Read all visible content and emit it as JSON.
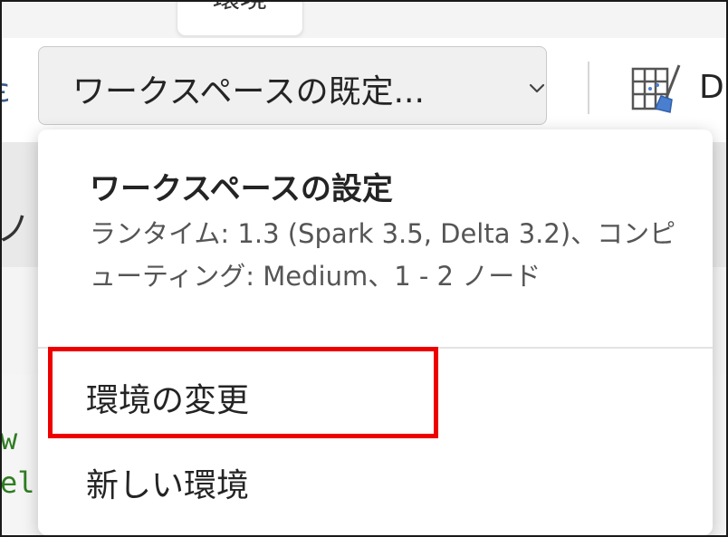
{
  "top_tab": {
    "label": "環境"
  },
  "toolbar": {
    "environment_dropdown": {
      "label": "ワークスペースの既定...",
      "icon": "chevron-down-icon"
    },
    "left_edge_glyph": "ε",
    "partial_tool": {
      "label": "D",
      "icon": "table-brush-icon"
    }
  },
  "background": {
    "left_text": "ノ",
    "code_lines": [
      "w",
      "el"
    ]
  },
  "menu": {
    "header": {
      "title": "ワークスペースの設定",
      "description": "ランタイム: 1.3 (Spark 3.5, Delta 3.2)、コンピューティング: Medium、1 - 2 ノード"
    },
    "items": [
      {
        "label": "環境の変更"
      },
      {
        "label": "新しい環境"
      }
    ]
  },
  "colors": {
    "highlight": "#ee0000",
    "code_text": "#2f7d22",
    "icon_accent": "#4a7fd0"
  }
}
